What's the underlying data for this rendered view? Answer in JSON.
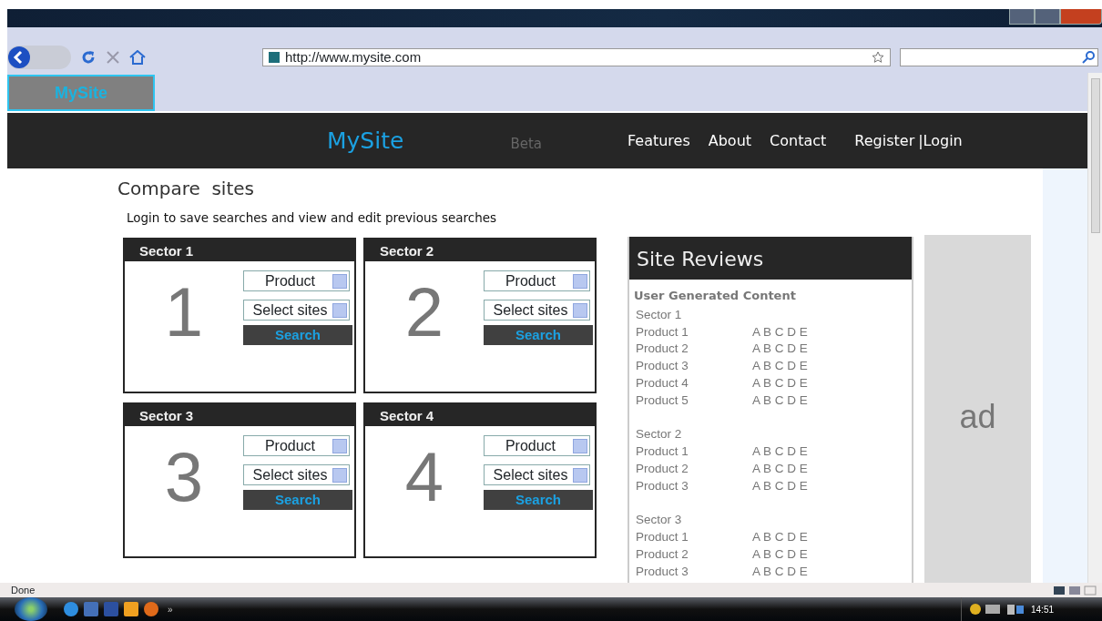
{
  "browser": {
    "address": "http://www.mysite.com",
    "tabs": [
      {
        "label": "MySite",
        "selected": true
      }
    ]
  },
  "site": {
    "logo": "MySite",
    "badge": "Beta",
    "nav": [
      "Features",
      "About",
      "Contact"
    ],
    "register": "Register",
    "separator": "|",
    "login": "Login"
  },
  "page": {
    "heading": "Compare  sites",
    "intro": "Login to save searches and view and edit previous searches"
  },
  "sectors": [
    {
      "title": "Sector 1",
      "number": "1",
      "product": "Product",
      "sites": "Select sites",
      "button": "Search"
    },
    {
      "title": "Sector 2",
      "number": "2",
      "product": "Product",
      "sites": "Select sites",
      "button": "Search"
    },
    {
      "title": "Sector 3",
      "number": "3",
      "product": "Product",
      "sites": "Select sites",
      "button": "Search"
    },
    {
      "title": "Sector 4",
      "number": "4",
      "product": "Product",
      "sites": "Select sites",
      "button": "Search"
    }
  ],
  "reviews": {
    "title": "Site Reviews",
    "subtitle": "User Generated Content",
    "groups": [
      {
        "title": "Sector 1",
        "rows": [
          {
            "product": "Product 1",
            "grades": "A B C D E"
          },
          {
            "product": "Product 2",
            "grades": "A B C D E"
          },
          {
            "product": "Product 3",
            "grades": "A B C D E"
          },
          {
            "product": "Product 4",
            "grades": "A B C D E"
          },
          {
            "product": "Product 5",
            "grades": "A B C D E"
          }
        ]
      },
      {
        "title": "Sector 2",
        "rows": [
          {
            "product": "Product 1",
            "grades": "A B C D E"
          },
          {
            "product": "Product 2",
            "grades": "A B C D E"
          },
          {
            "product": "Product 3",
            "grades": "A B C D E"
          }
        ]
      },
      {
        "title": "Sector 3",
        "rows": [
          {
            "product": "Product 1",
            "grades": "A B C D E"
          },
          {
            "product": "Product 2",
            "grades": "A B C D E"
          },
          {
            "product": "Product 3",
            "grades": "A B C D E"
          }
        ]
      }
    ]
  },
  "ad": {
    "label": "ad"
  },
  "status_bar": {
    "text": "Done"
  },
  "taskbar": {
    "clock": "14:51",
    "overflow": "»"
  }
}
